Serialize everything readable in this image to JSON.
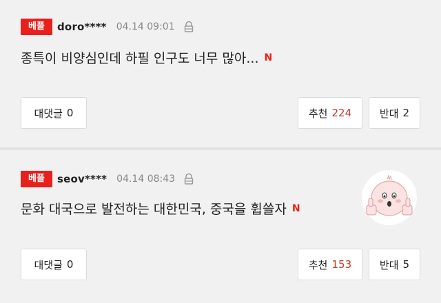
{
  "comments": [
    {
      "badge": "베플",
      "user": "doro****",
      "time": "04.14 09:01",
      "text": "종특이 비양심인데 하필 인구도 너무 많아...",
      "reply_label": "대댓글",
      "reply_count": "0",
      "recommend_label": "추천",
      "recommend_count": "224",
      "oppose_label": "반대",
      "oppose_count": "2"
    },
    {
      "badge": "베플",
      "user": "seov****",
      "time": "04.14 08:43",
      "text": "문화 대국으로 발전하는 대한민국, 중국을 휩쓸자",
      "reply_label": "대댓글",
      "reply_count": "0",
      "recommend_label": "추천",
      "recommend_count": "153",
      "oppose_label": "반대",
      "oppose_count": "5"
    }
  ],
  "icons": {
    "lock": "lock-icon",
    "naver": "N",
    "sticker": "thumbs-up-sticker-icon"
  },
  "colors": {
    "badge": "#e8201d",
    "recommend_count": "#c23a2c",
    "background": "#f1f1f1"
  }
}
